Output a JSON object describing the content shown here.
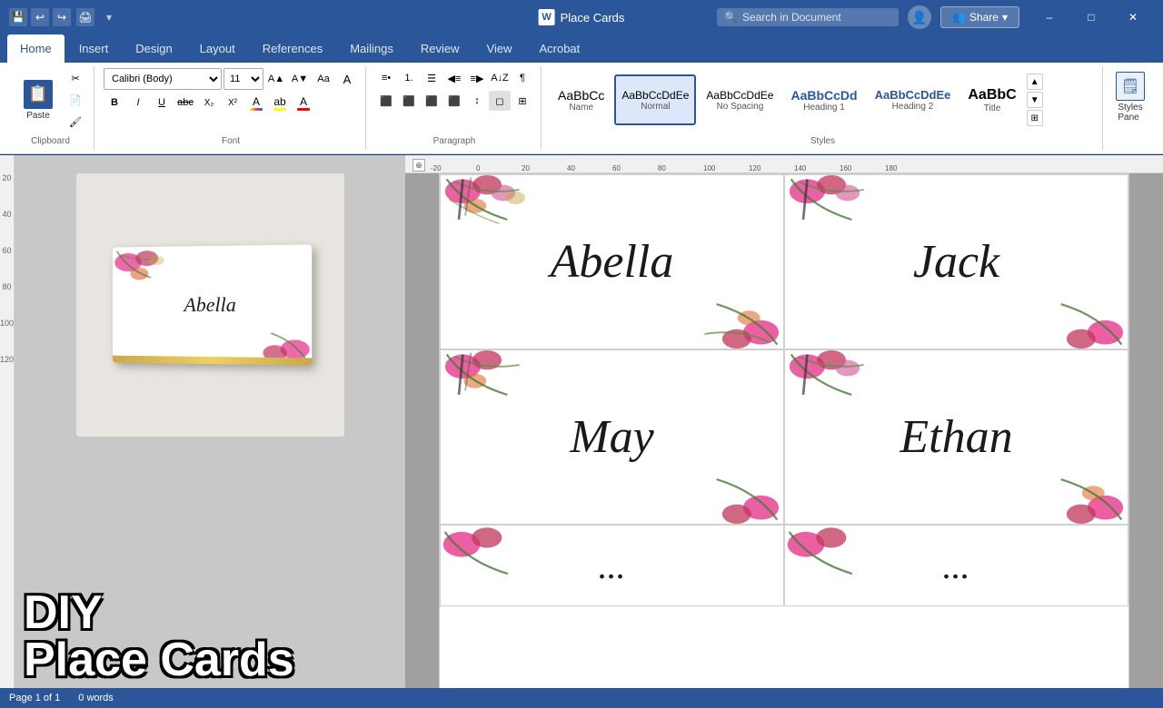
{
  "titlebar": {
    "title": "Place Cards",
    "word_icon": "W",
    "search_placeholder": "Search in Document",
    "share_label": "Share",
    "window_controls": [
      "–",
      "□",
      "✕"
    ]
  },
  "ribbon": {
    "tabs": [
      "Home",
      "Insert",
      "Design",
      "Layout",
      "References",
      "Mailings",
      "Review",
      "View",
      "Acrobat"
    ],
    "active_tab": "Home",
    "font_name": "Calibri (Body)",
    "font_size": "11",
    "paste_label": "Paste",
    "styles_pane_label": "Styles\nPane",
    "styles": [
      {
        "id": "name",
        "label": "Name",
        "preview": "AaBbCc"
      },
      {
        "id": "normal",
        "label": "Normal",
        "preview": "AaBbCcDdEe",
        "selected": true
      },
      {
        "id": "no-spacing",
        "label": "No Spacing",
        "preview": "AaBbCcDdEe"
      },
      {
        "id": "heading1",
        "label": "Heading 1",
        "preview": "AaBbCcDd"
      },
      {
        "id": "heading2",
        "label": "Heading 2",
        "preview": "AaBbCcDdEe"
      },
      {
        "id": "title",
        "label": "Title",
        "preview": "AaBbC"
      }
    ]
  },
  "document": {
    "title": "Place Cards",
    "place_cards": [
      {
        "name": "Abella",
        "row": 0,
        "col": 0
      },
      {
        "name": "Jack",
        "row": 0,
        "col": 1
      },
      {
        "name": "May",
        "row": 1,
        "col": 0
      },
      {
        "name": "Ethan",
        "row": 1,
        "col": 1
      },
      {
        "name": "...",
        "row": 2,
        "col": 0
      },
      {
        "name": "...",
        "row": 2,
        "col": 1
      }
    ]
  },
  "thumbnail": {
    "preview_name": "Abella",
    "diy_line1": "DIY",
    "diy_line2": "Place Cards"
  },
  "ruler": {
    "marks": [
      "-20",
      "0",
      "20",
      "40",
      "60",
      "80",
      "100",
      "120",
      "140",
      "160",
      "180"
    ],
    "v_marks": [
      "20",
      "40",
      "60",
      "80",
      "100",
      "120"
    ]
  },
  "status": {
    "page": "Page 1 of 1",
    "words": "0 words"
  }
}
